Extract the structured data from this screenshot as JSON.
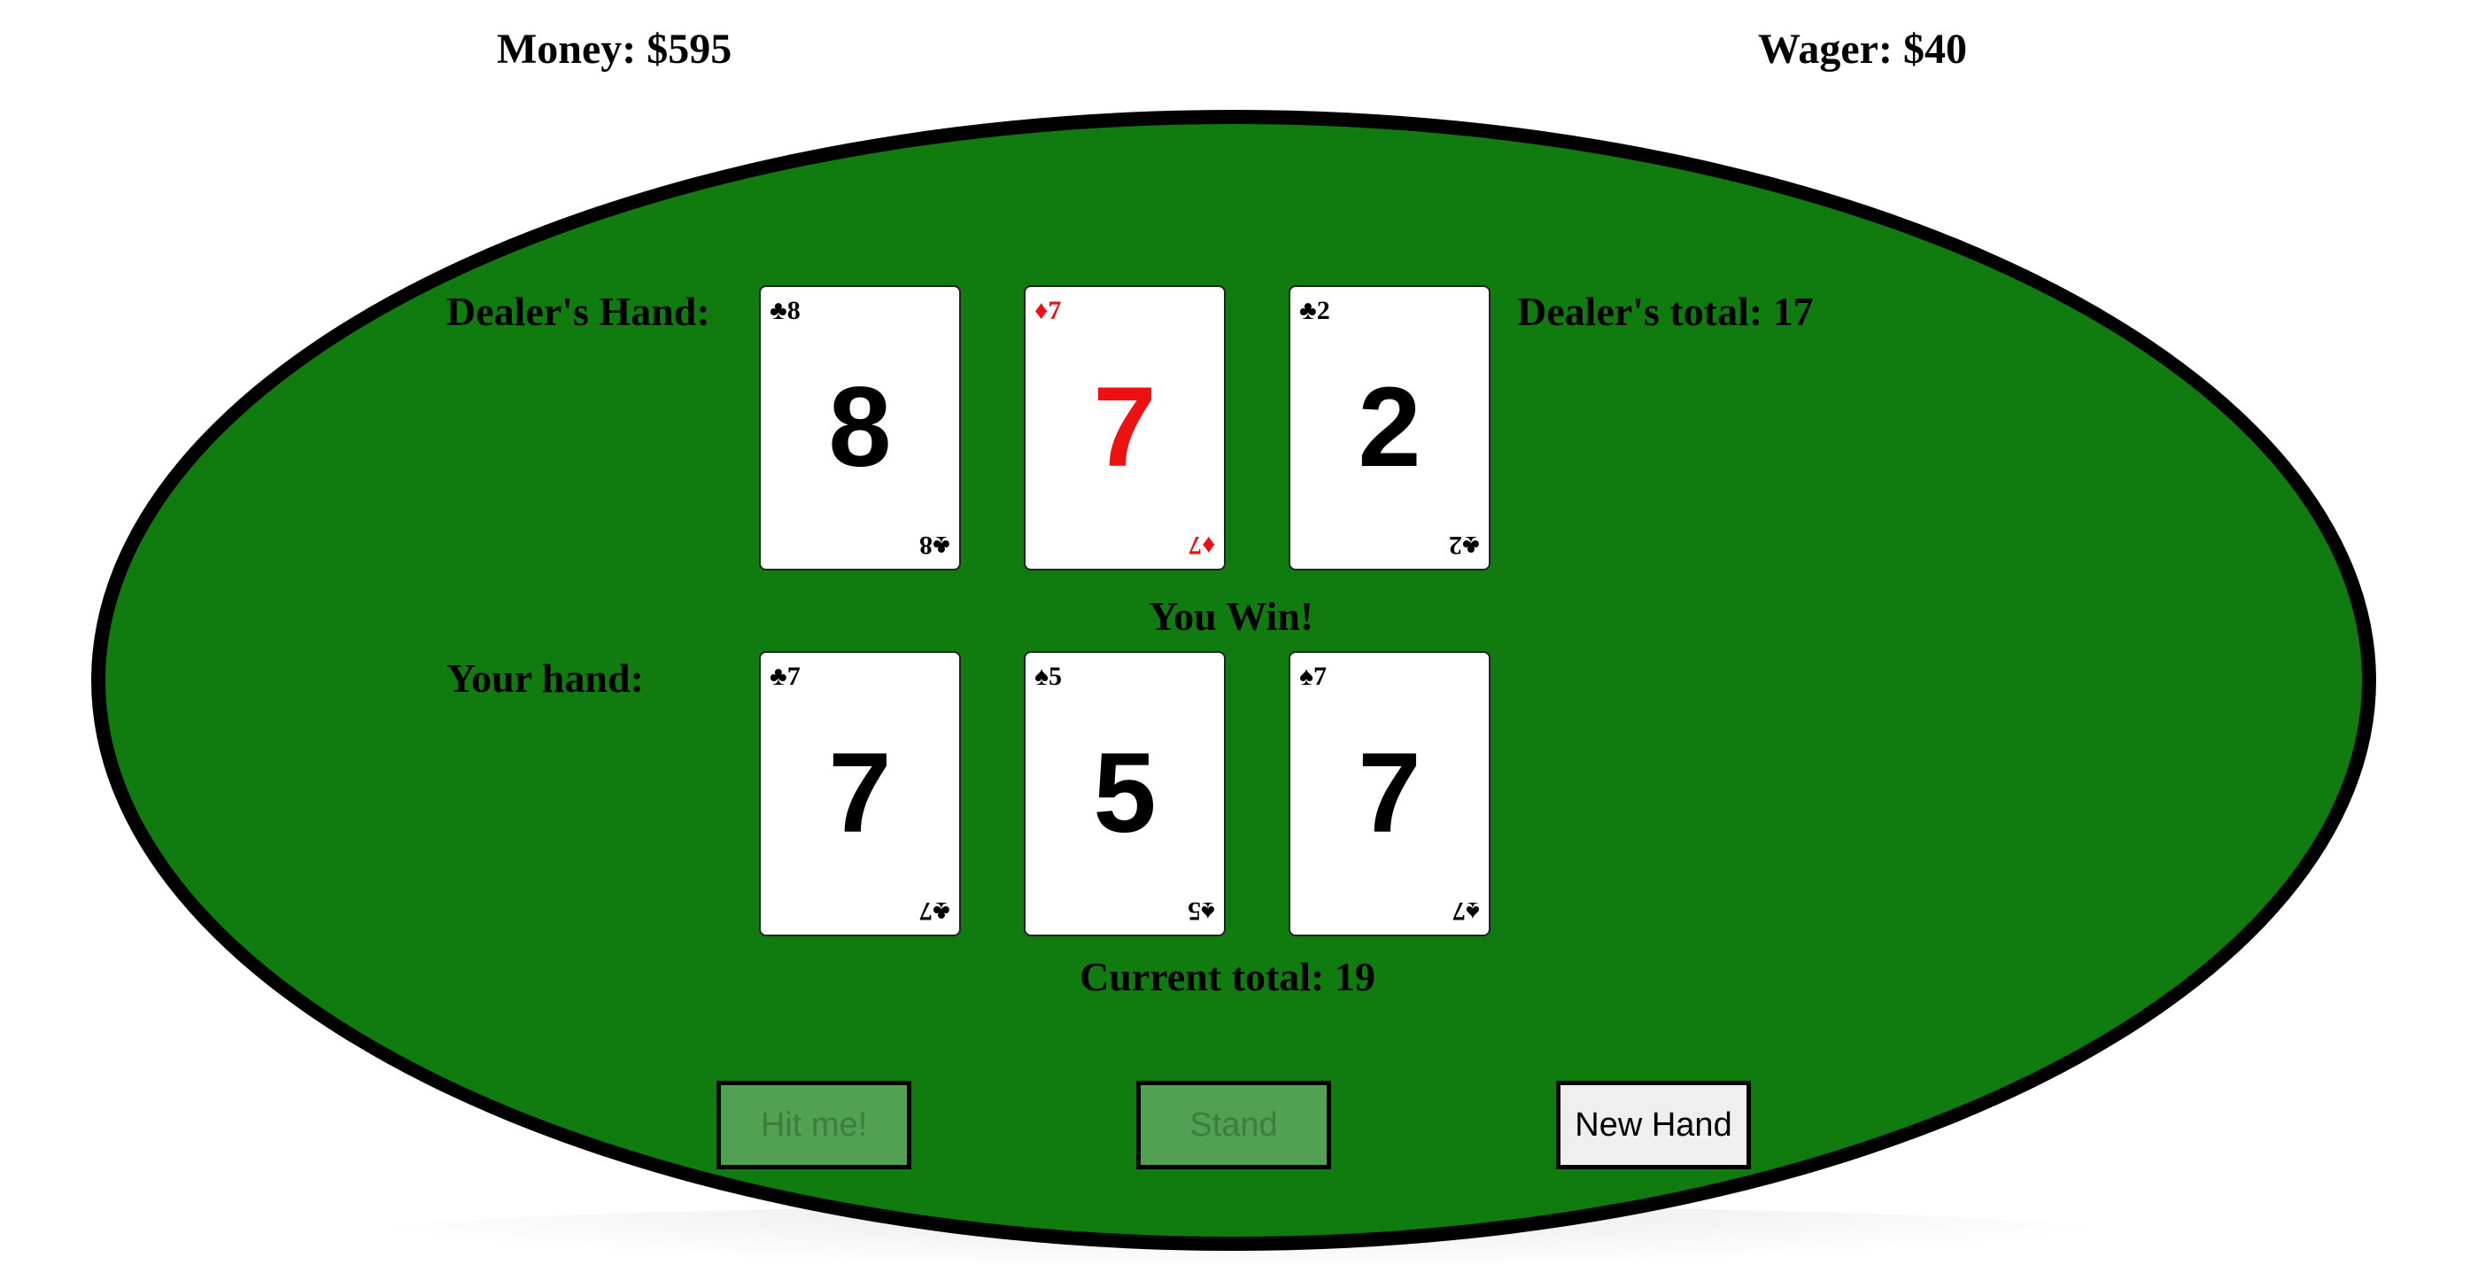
{
  "header": {
    "money_label": "Money: $595",
    "wager_label": "Wager: $40"
  },
  "table": {
    "felt_color": "#107c10",
    "rim_color": "#000000"
  },
  "dealer": {
    "label": "Dealer's Hand:",
    "total_label": "Dealer's total: 17",
    "cards": [
      {
        "rank": "8",
        "suit": "♣",
        "suit_name": "clubs",
        "color": "#000000"
      },
      {
        "rank": "7",
        "suit": "♦",
        "suit_name": "diamonds",
        "color": "#ee1111"
      },
      {
        "rank": "2",
        "suit": "♣",
        "suit_name": "clubs",
        "color": "#000000"
      }
    ]
  },
  "result": "You Win!",
  "player": {
    "label": "Your hand:",
    "total_label": "Current total: 19",
    "cards": [
      {
        "rank": "7",
        "suit": "♣",
        "suit_name": "clubs",
        "color": "#000000"
      },
      {
        "rank": "5",
        "suit": "♠",
        "suit_name": "spades",
        "color": "#000000"
      },
      {
        "rank": "7",
        "suit": "♠",
        "suit_name": "spades",
        "color": "#000000"
      }
    ]
  },
  "controls": {
    "hit_label": "Hit me!",
    "stand_label": "Stand",
    "new_hand_label": "New Hand"
  }
}
